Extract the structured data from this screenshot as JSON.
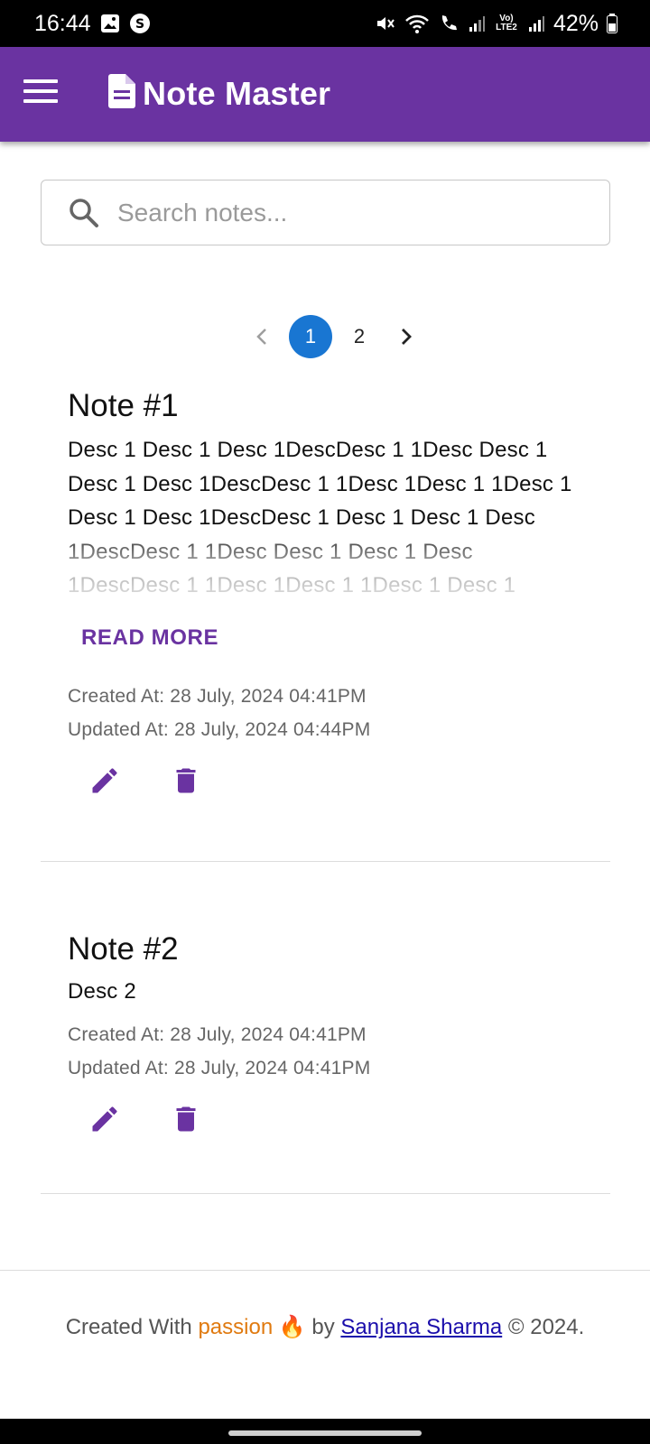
{
  "status_bar": {
    "time": "16:44",
    "battery": "42%",
    "network_label": "Vo) LTE2",
    "icons": [
      "gallery-icon",
      "s-app-icon",
      "mute-icon",
      "wifi-icon",
      "call-icon",
      "signal-icon",
      "signal-icon",
      "battery-icon"
    ]
  },
  "app_bar": {
    "title": "Note Master",
    "menu_icon": "hamburger-menu-icon",
    "logo_icon": "document-icon",
    "color": "#6a33a1"
  },
  "search": {
    "placeholder": "Search notes...",
    "value": ""
  },
  "pagination": {
    "prev": "‹",
    "pages": [
      "1",
      "2"
    ],
    "active_page": "1",
    "next": "›",
    "active_color": "#1976d2"
  },
  "notes": [
    {
      "title": "Note #1",
      "description": "Desc 1 Desc 1 Desc 1DescDesc 1 1Desc Desc 1 Desc 1 Desc 1DescDesc 1 1Desc 1Desc 1 1Desc 1 Desc 1 Desc 1DescDesc 1 Desc 1 Desc 1 Desc 1DescDesc 1 1Desc Desc 1 Desc 1 Desc 1DescDesc 1 1Desc 1Desc 1 1Desc 1 Desc 1",
      "read_more": "READ MORE",
      "created": "Created At: 28 July, 2024 04:41PM",
      "updated": "Updated At: 28 July, 2024 04:44PM"
    },
    {
      "title": "Note #2",
      "description": "Desc 2",
      "created": "Created At: 28 July, 2024 04:41PM",
      "updated": "Updated At: 28 July, 2024 04:41PM"
    }
  ],
  "footer": {
    "prefix": "Created With ",
    "passion": "passion",
    "emoji": "🔥",
    "by": " by ",
    "author": "Sanjana Sharma",
    "suffix": " © 2024."
  }
}
